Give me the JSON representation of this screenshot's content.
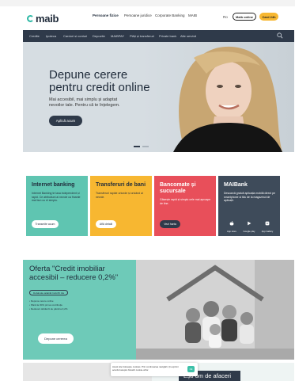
{
  "header": {
    "logo": "maib",
    "nav": [
      {
        "label": "Persoane fizice",
        "active": true
      },
      {
        "label": "Persoane juridice",
        "active": false
      },
      {
        "label": "Corporate Banking",
        "active": false
      },
      {
        "label": "MAIB",
        "active": false
      }
    ],
    "language": "Ro",
    "login_button": "Maib online",
    "card_button": "Card 24h"
  },
  "subnav": {
    "items": [
      "Credite",
      "Ipoteca",
      "Carduri si conturi",
      "Depozite",
      "MAIBPAY",
      "Plăți și transferuri",
      "Private bank",
      "Alte servicii"
    ]
  },
  "hero": {
    "title": "Depune cerere pentru credit online",
    "subtitle": "Mai accesibil, mai simplu și adaptat nevoilor tale. Pentru că te înțelegem.",
    "button": "Aplică acum"
  },
  "cards": [
    {
      "title": "Internet banking",
      "desc": "Internet Banking te lasa independent și rapid. Ce atributiuni ai nevoie ca finante mai bun cu el simplu.",
      "button": "Transmite acum",
      "bg": "#5fc5b1",
      "fg": "#1f2b3a"
    },
    {
      "title": "Transferuri de bani",
      "desc": "Transferuri rapide oriunde și oricând ai nevoie.",
      "button": "Află detalii",
      "bg": "#f7b731",
      "fg": "#1f2b3a"
    },
    {
      "title": "Bancomate și sucursale",
      "desc": "Găsește rapid și simplu cele mai aproape de tine.",
      "button": "Vezi harta",
      "bg": "#e84f5a",
      "fg": "#ffffff"
    },
    {
      "title": "MAIBank",
      "desc": "Descarcă gratuit aplicația mobilă direct pe smartphone ul tău de la magazinul de aplicații.",
      "bg": "#3e4b5a",
      "fg": "#ffffff",
      "stores": [
        "App store",
        "Google play",
        "App Gallery"
      ]
    }
  ],
  "offer": {
    "title": "Oferta \"Credit imobiliar accesibil – reducere 0,2%\"",
    "badge": "Dobânda valabilă încă 80 zile",
    "bullets": [
      "Depune cerere online",
      "Până la 30% prima contribuție",
      "Reduceri dobânzii de până la 0,2%"
    ],
    "button": "Depune cererea"
  },
  "bottom": {
    "business_title": "Ești om de afaceri"
  },
  "cookie": {
    "text": "Acest site folosește cookies. Prin continuarea navigării, îți exprimi acordul asupra folosirii cookie-urilor.",
    "ok": "Ok"
  }
}
